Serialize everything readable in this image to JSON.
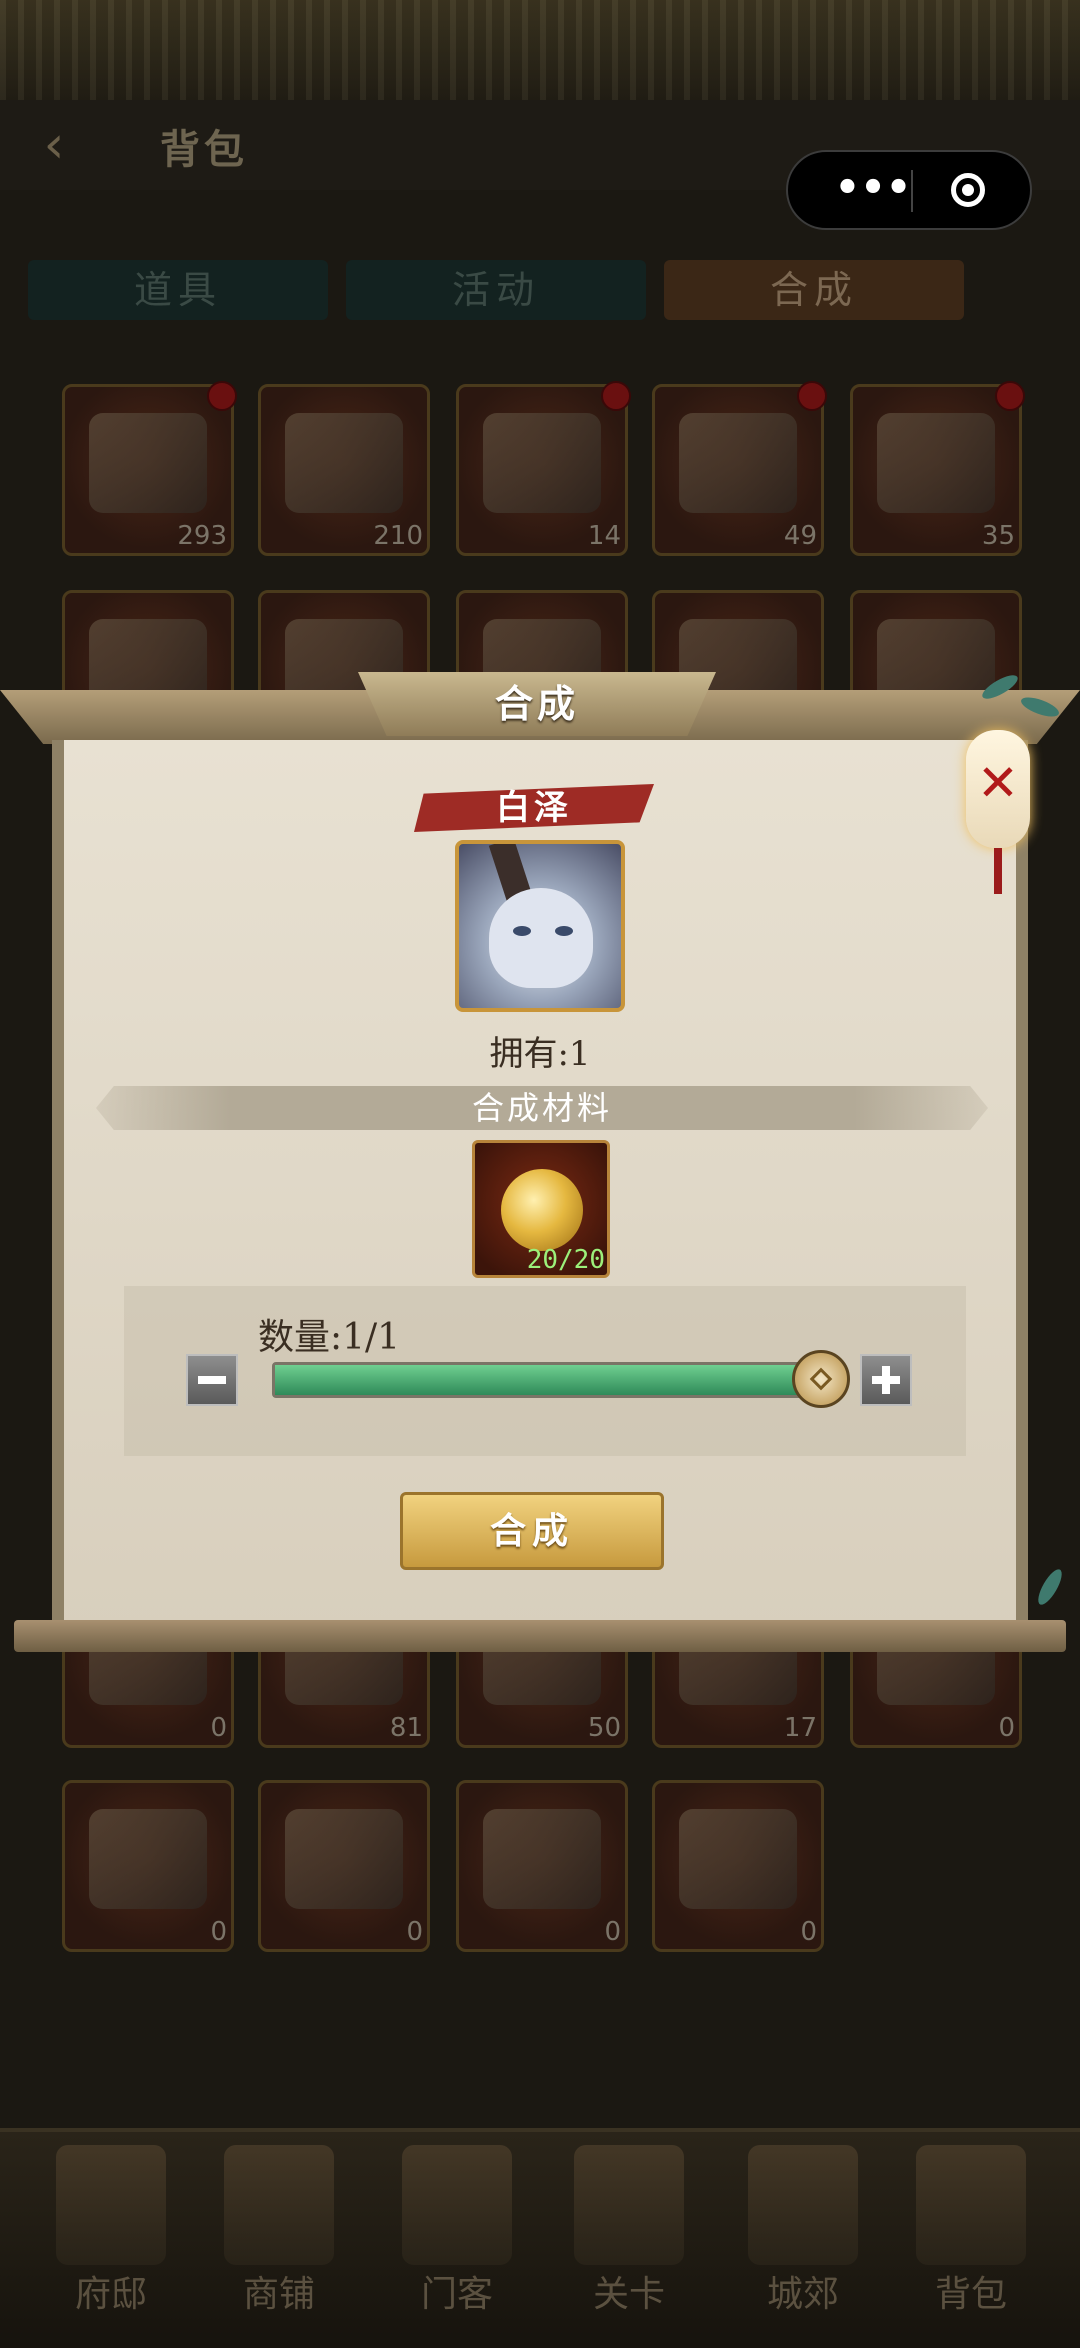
{
  "header": {
    "title": "背包",
    "back_icon": "chevron-left-icon"
  },
  "capsule": {
    "more_icon": "more-dots-icon",
    "close_icon": "target-circle-icon"
  },
  "tabs": [
    {
      "label": "道具",
      "active": false
    },
    {
      "label": "活动",
      "active": false
    },
    {
      "label": "合成",
      "active": true
    }
  ],
  "grid_items": [
    {
      "count": "293",
      "badge": true
    },
    {
      "count": "210",
      "badge": false
    },
    {
      "count": "14",
      "badge": true
    },
    {
      "count": "49",
      "badge": true
    },
    {
      "count": "35",
      "badge": true
    },
    {
      "count": "",
      "badge": false
    },
    {
      "count": "",
      "badge": false
    },
    {
      "count": "",
      "badge": false
    },
    {
      "count": "",
      "badge": false
    },
    {
      "count": "",
      "badge": false
    },
    {
      "count": "0",
      "badge": false
    },
    {
      "count": "81",
      "badge": false
    },
    {
      "count": "50",
      "badge": false
    },
    {
      "count": "17",
      "badge": false
    },
    {
      "count": "0",
      "badge": false
    },
    {
      "count": "0",
      "badge": false
    },
    {
      "count": "0",
      "badge": false
    },
    {
      "count": "0",
      "badge": false
    },
    {
      "count": "0",
      "badge": false
    }
  ],
  "bottom_nav": [
    {
      "label": "府邸"
    },
    {
      "label": "商铺"
    },
    {
      "label": "门客"
    },
    {
      "label": "关卡"
    },
    {
      "label": "城郊"
    },
    {
      "label": "背包"
    }
  ],
  "modal": {
    "title": "合成",
    "item_name": "白泽",
    "owned_text": "拥有:1",
    "materials_title": "合成材料",
    "material_count": "20/20",
    "quantity_text": "数量:1/1",
    "quantity_fraction": 1.0,
    "craft_label": "合成",
    "close_icon": "close-x-icon"
  },
  "colors": {
    "accent_red": "#9e2b25",
    "progress_green": "#2f8a59",
    "gold": "#c79a3e"
  }
}
